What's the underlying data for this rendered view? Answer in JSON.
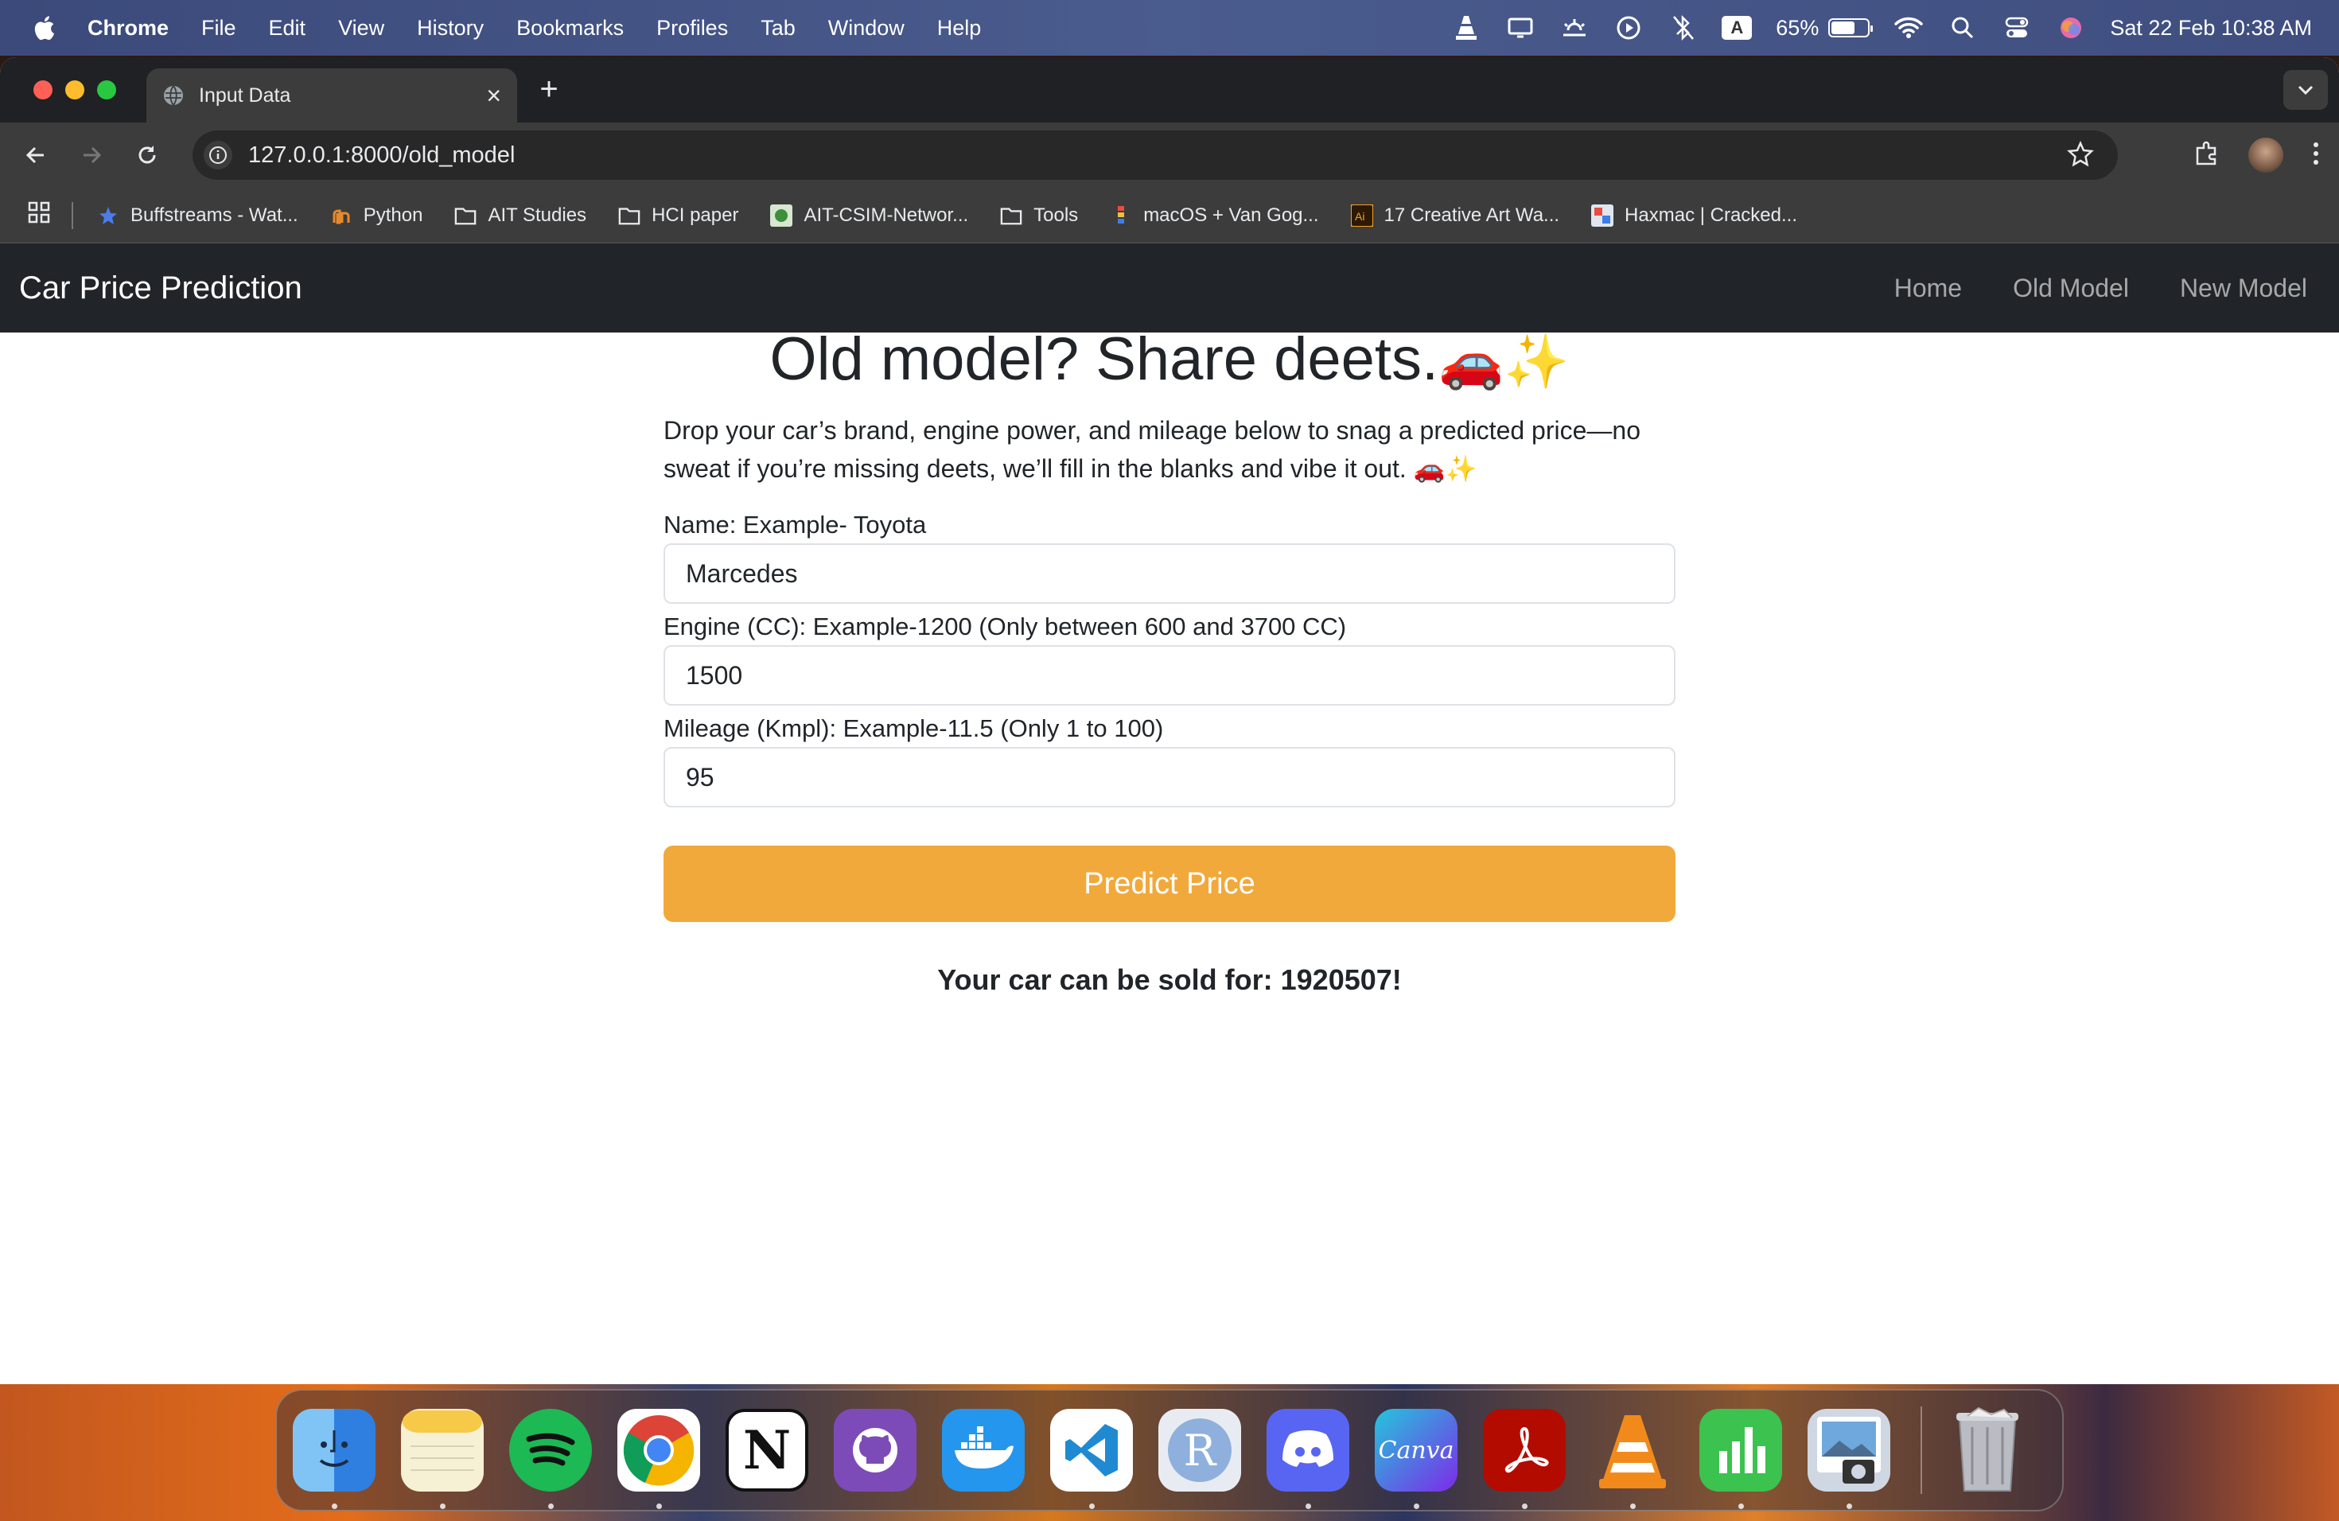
{
  "menubar": {
    "app_name": "Chrome",
    "menus": [
      "File",
      "Edit",
      "View",
      "History",
      "Bookmarks",
      "Profiles",
      "Tab",
      "Window",
      "Help"
    ],
    "battery_percent": "65%",
    "battery_level": 0.65,
    "input_source": "A",
    "datetime": "Sat 22 Feb  10:38 AM"
  },
  "browser": {
    "tab_title": "Input Data",
    "url": "127.0.0.1:8000/old_model",
    "bookmarks": [
      {
        "label": "Buffstreams - Wat...",
        "icon": "star-icon"
      },
      {
        "label": "Python",
        "icon": "python-icon"
      },
      {
        "label": "AIT Studies",
        "icon": "folder-icon"
      },
      {
        "label": "HCI paper",
        "icon": "folder-icon"
      },
      {
        "label": "AIT-CSIM-Networ...",
        "icon": "site-icon"
      },
      {
        "label": "Tools",
        "icon": "folder-icon"
      },
      {
        "label": "macOS + Van Gog...",
        "icon": "site-icon"
      },
      {
        "label": "17 Creative Art Wa...",
        "icon": "illustrator-icon"
      },
      {
        "label": "Haxmac | Cracked...",
        "icon": "site-icon"
      }
    ]
  },
  "page": {
    "brand": "Car Price Prediction",
    "nav": [
      "Home",
      "Old Model",
      "New Model"
    ],
    "heading": "Old model? Share deets.",
    "heading_emoji": "🚗✨",
    "description": "Drop your car’s brand, engine power, and mileage below to snag a predicted price—no sweat if you’re missing deets, we’ll fill in the blanks and vibe it out. 🚗✨",
    "fields": [
      {
        "label": "Name: Example- Toyota",
        "value": "Marcedes"
      },
      {
        "label": "Engine (CC): Example-1200 (Only between 600 and 3700 CC)",
        "value": "1500"
      },
      {
        "label": "Mileage (Kmpl): Example-11.5 (Only 1 to 100)",
        "value": "95"
      }
    ],
    "submit_label": "Predict Price",
    "result": "Your car can be sold for: 1920507!",
    "accent_color": "#f2a93b",
    "navbar_color": "#212529"
  },
  "dock": {
    "apps": [
      {
        "name": "finder-icon",
        "color": "#3b8fe8",
        "running": true
      },
      {
        "name": "notes-icon",
        "color": "#f6f1d4",
        "running": true
      },
      {
        "name": "spotify-icon",
        "color": "#1db954",
        "running": true
      },
      {
        "name": "chrome-icon",
        "color": "#ffffff",
        "running": true
      },
      {
        "name": "notion-icon",
        "color": "#ffffff",
        "running": false
      },
      {
        "name": "github-desktop-icon",
        "color": "#7d4bb8",
        "running": false
      },
      {
        "name": "docker-icon",
        "color": "#2496ed",
        "running": false
      },
      {
        "name": "vscode-icon",
        "color": "#ffffff",
        "running": true
      },
      {
        "name": "r-icon",
        "color": "#e8ecf2",
        "running": false
      },
      {
        "name": "discord-icon",
        "color": "#5865f2",
        "running": true
      },
      {
        "name": "canva-icon",
        "color": "#7d2ae8",
        "running": true
      },
      {
        "name": "acrobat-icon",
        "color": "#b30b00",
        "running": true
      },
      {
        "name": "vlc-icon",
        "color": "transparent",
        "running": true
      },
      {
        "name": "numbers-icon",
        "color": "#3cc24f",
        "running": true
      },
      {
        "name": "preview-icon",
        "color": "#cfd7e3",
        "running": true
      }
    ],
    "canva_text": "Canva",
    "r_text": "R",
    "notion_text": "N"
  }
}
